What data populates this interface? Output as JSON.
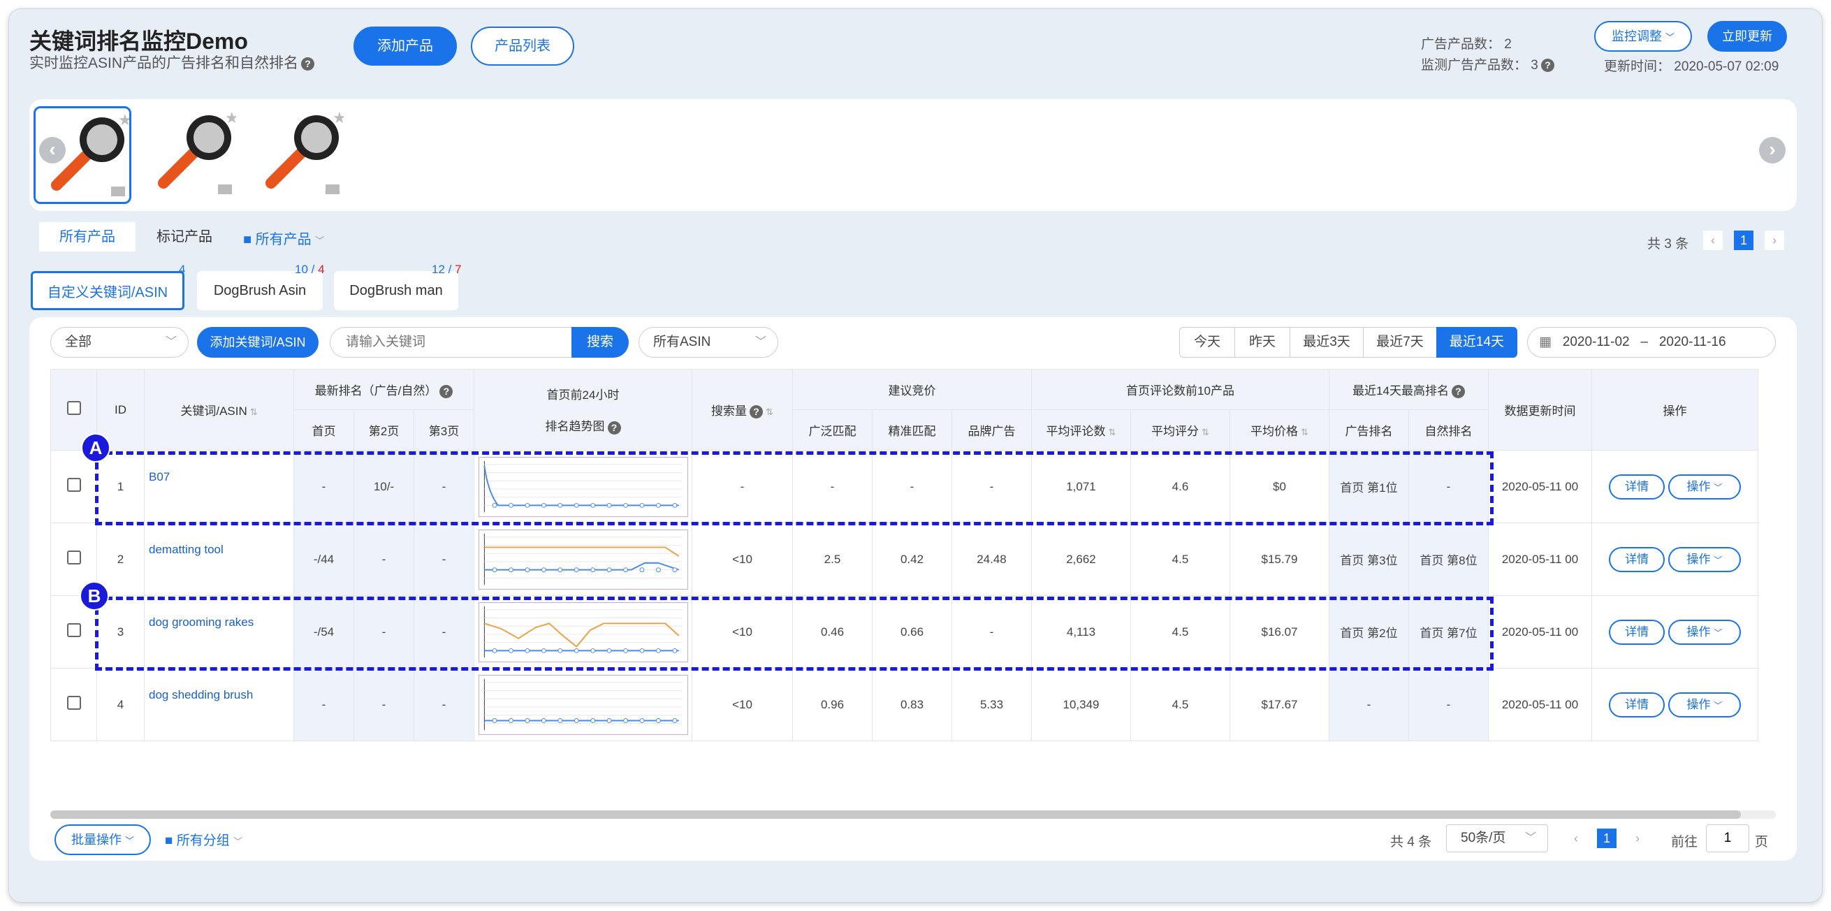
{
  "header": {
    "title": "关键词排名监控Demo",
    "subtitle": "实时监控ASIN产品的广告排名和自然排名",
    "add_product": "添加产品",
    "product_list": "产品列表",
    "ad_count_label": "广告产品数：",
    "ad_count": "2",
    "monitor_count_label": "监测广告产品数：",
    "monitor_count": "3",
    "monitor_adjust": "监控调整",
    "update_now": "立即更新",
    "update_time_label": "更新时间：",
    "update_time": "2020-05-07 02:09"
  },
  "filter_tabs": {
    "all": "所有产品",
    "marked": "标记产品",
    "folder": "所有产品"
  },
  "top_pager": {
    "total": "共 3 条",
    "page": "1"
  },
  "keyword_tabs": [
    {
      "label": "自定义关键词/ASIN",
      "badge": "4",
      "badge2": ""
    },
    {
      "label": "DogBrush Asin",
      "badge": "10 / ",
      "badge2": "4"
    },
    {
      "label": "DogBrush man",
      "badge": "12 / ",
      "badge2": "7"
    }
  ],
  "toolbar": {
    "scope": "全部",
    "add_keyword": "添加关键词/ASIN",
    "search_placeholder": "请输入关键词",
    "search": "搜索",
    "asin_select": "所有ASIN",
    "ranges": [
      "今天",
      "昨天",
      "最近3天",
      "最近7天",
      "最近14天"
    ],
    "date_from": "2020-11-02",
    "date_sep": "–",
    "date_to": "2020-11-16"
  },
  "table": {
    "h_id": "ID",
    "h_kw": "关键词/ASIN",
    "h_latest": "最新排名（广告/自然）",
    "h_p1": "首页",
    "h_p2": "第2页",
    "h_p3": "第3页",
    "h_trend1": "首页前24小时",
    "h_trend2": "排名趋势图",
    "h_search": "搜索量",
    "h_bid": "建议竞价",
    "h_broad": "广泛匹配",
    "h_exact": "精准匹配",
    "h_brand": "品牌广告",
    "h_top10": "首页评论数前10产品",
    "h_reviews": "平均评论数",
    "h_rating": "平均评分",
    "h_price": "平均价格",
    "h_best": "最近14天最高排名",
    "h_adrank": "广告排名",
    "h_natrank": "自然排名",
    "h_updated": "数据更新时间",
    "h_ops": "操作",
    "detail": "详情",
    "op": "操作",
    "rows": [
      {
        "id": "1",
        "kw": "B07",
        "p1": "-",
        "p2": "10/-",
        "p3": "-",
        "search": "-",
        "broad": "-",
        "exact": "-",
        "brand": "-",
        "reviews": "1,071",
        "rating": "4.6",
        "price": "$0",
        "adrank": "首页 第1位",
        "natrank": "-",
        "updated": "2020-05-11 00"
      },
      {
        "id": "2",
        "kw": "dematting tool",
        "p1": "-/44",
        "p2": "-",
        "p3": "-",
        "search": "<10",
        "broad": "2.5",
        "exact": "0.42",
        "brand": "24.48",
        "reviews": "2,662",
        "rating": "4.5",
        "price": "$15.79",
        "adrank": "首页 第3位",
        "natrank": "首页 第8位",
        "updated": "2020-05-11 00"
      },
      {
        "id": "3",
        "kw": "dog grooming rakes",
        "p1": "-/54",
        "p2": "-",
        "p3": "-",
        "search": "<10",
        "broad": "0.46",
        "exact": "0.66",
        "brand": "-",
        "reviews": "4,113",
        "rating": "4.5",
        "price": "$16.07",
        "adrank": "首页 第2位",
        "natrank": "首页 第7位",
        "updated": "2020-05-11 00"
      },
      {
        "id": "4",
        "kw": "dog shedding brush",
        "p1": "-",
        "p2": "-",
        "p3": "-",
        "search": "<10",
        "broad": "0.96",
        "exact": "0.83",
        "brand": "5.33",
        "reviews": "10,349",
        "rating": "4.5",
        "price": "$17.67",
        "adrank": "-",
        "natrank": "-",
        "updated": "2020-05-11 00"
      }
    ]
  },
  "footer": {
    "batch": "批量操作",
    "groups": "所有分组",
    "total": "共 4 条",
    "per_page": "50条/页",
    "page": "1",
    "goto": "前往",
    "goto_value": "1",
    "page_suffix": "页"
  },
  "annotations": [
    "A",
    "B"
  ],
  "colors": {
    "accent": "#1a73e8",
    "orange": "#f0a040",
    "annotation": "#1a1adc"
  }
}
